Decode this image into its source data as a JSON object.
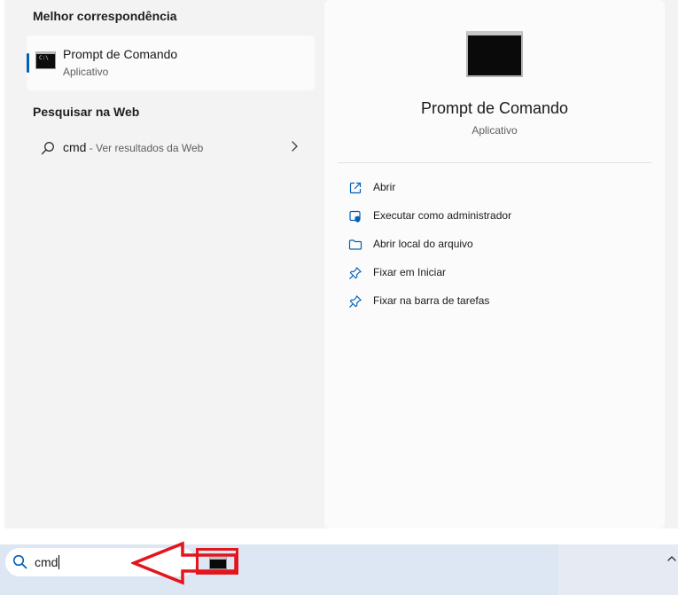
{
  "left_pane": {
    "best_match_heading": "Melhor correspondência",
    "best_match": {
      "name": "Prompt de Comando",
      "type": "Aplicativo",
      "icon": "command-prompt-icon"
    },
    "web_heading": "Pesquisar na Web",
    "web_result": {
      "query": "cmd",
      "suffix": " - Ver resultados da Web",
      "icon": "search-icon"
    }
  },
  "right_pane": {
    "app_name": "Prompt de Comando",
    "app_type": "Aplicativo",
    "actions": [
      {
        "label": "Abrir",
        "icon": "open-external-icon"
      },
      {
        "label": "Executar como administrador",
        "icon": "admin-shield-icon"
      },
      {
        "label": "Abrir local do arquivo",
        "icon": "folder-icon"
      },
      {
        "label": "Fixar em Iniciar",
        "icon": "pin-icon"
      },
      {
        "label": "Fixar na barra de tarefas",
        "icon": "pin-icon"
      }
    ]
  },
  "taskbar": {
    "search_value": "cmd",
    "search_icon": "search-icon",
    "highlighted_app_icon": "command-prompt-icon",
    "tray_icon": "chevron-up-icon"
  },
  "colors": {
    "accent": "#005fb8",
    "annotation": "#e4151c",
    "panel_bg": "#f3f3f3",
    "taskbar_bg": "#dde6f3"
  }
}
